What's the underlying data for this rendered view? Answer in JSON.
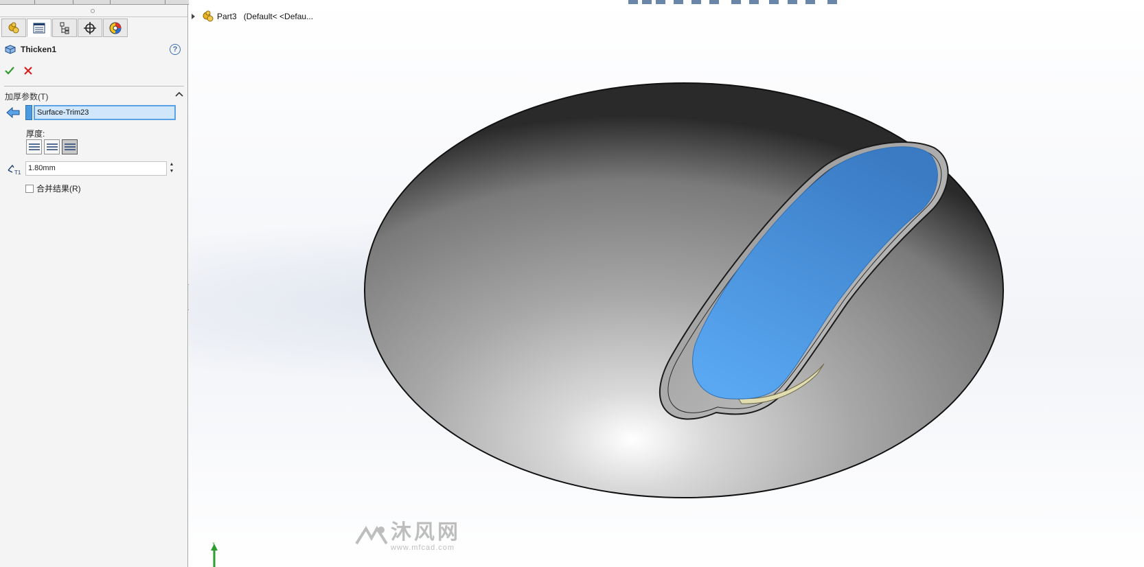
{
  "feature": {
    "name": "Thicken1",
    "help_icon": "help-icon",
    "help_label": "?"
  },
  "panel_tabs": [
    {
      "name": "feature-manager-icon",
      "active": false
    },
    {
      "name": "property-manager-icon",
      "active": true
    },
    {
      "name": "configuration-manager-icon",
      "active": false
    },
    {
      "name": "dimxpert-manager-icon",
      "active": false
    },
    {
      "name": "display-manager-icon",
      "active": false
    }
  ],
  "actions": {
    "ok_icon": "checkmark-icon",
    "cancel_icon": "close-icon"
  },
  "thicken_params": {
    "title": "加厚参数(T)",
    "selection": "Surface-Trim23",
    "thickness_label": "厚度:",
    "thickness_value": "1.80mm",
    "side_options": [
      "thicken-side-1",
      "thicken-both-sides",
      "thicken-side-2"
    ],
    "selected_side": "thicken-side-2",
    "merge_label": "合并结果(R)",
    "merge_checked": false
  },
  "tree": {
    "part_name": "Part3",
    "configuration": "(Default< <Defau..."
  },
  "watermark": {
    "text": "沐风网",
    "url": "www.mfcad.com"
  },
  "colors": {
    "selection_blue": "#4b9be3",
    "face_blue": "#4a8fd6",
    "model_gray": "#9a9a9a",
    "ok_green": "#2e9b2e",
    "cancel_red": "#d62020"
  }
}
